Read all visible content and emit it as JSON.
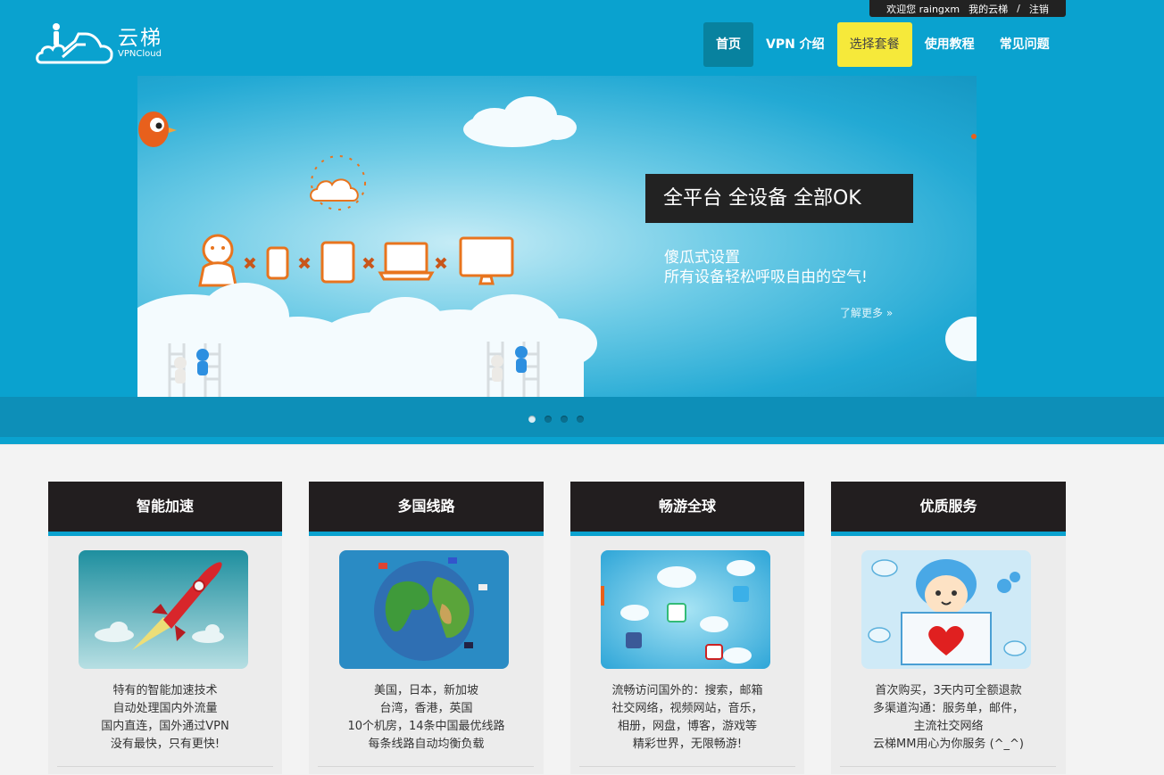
{
  "userbar": {
    "welcome": "欢迎您 raingxm",
    "my_account": "我的云梯",
    "separator": "/",
    "logout": "注销"
  },
  "logo": {
    "name_cn": "云梯",
    "name_en": "VPNCloud"
  },
  "nav": {
    "items": [
      {
        "label": "首页",
        "state": "active"
      },
      {
        "label": "VPN 介绍",
        "state": "normal"
      },
      {
        "label": "选择套餐",
        "state": "highlight"
      },
      {
        "label": "使用教程",
        "state": "normal"
      },
      {
        "label": "常见问题",
        "state": "normal"
      }
    ]
  },
  "slider": {
    "caption_title": "全平台 全设备 全部OK",
    "caption_line1": "傻瓜式设置",
    "caption_line2": "所有设备轻松呼吸自由的空气!",
    "more_link": "了解更多 »",
    "slide_count": 4,
    "active_slide": 1
  },
  "features": [
    {
      "title": "智能加速",
      "image": "rocket-image",
      "lines": [
        "特有的智能加速技术",
        "自动处理国内外流量",
        "国内直连，国外通过VPN",
        "没有最快，只有更快!"
      ]
    },
    {
      "title": "多国线路",
      "image": "globe-image",
      "lines": [
        "美国，日本，新加坡",
        "台湾，香港，英国",
        "10个机房，14条中国最优线路",
        "每条线路自动均衡负载"
      ]
    },
    {
      "title": "畅游全球",
      "image": "social-clouds-image",
      "lines": [
        "流畅访问国外的：搜索，邮箱",
        "社交网络，视频网站，音乐，",
        "相册，网盘，博客，游戏等",
        "精彩世界，无限畅游!"
      ]
    },
    {
      "title": "优质服务",
      "image": "mascot-image",
      "lines": [
        "首次购买，3天内可全额退款",
        "多渠道沟通：服务单，邮件，",
        "主流社交网络",
        "云梯MM用心为你服务 (^_^)"
      ]
    }
  ],
  "colors": {
    "brand_blue": "#0aa2cf",
    "dark": "#221e1f",
    "highlight_yellow": "#f6e93a"
  }
}
